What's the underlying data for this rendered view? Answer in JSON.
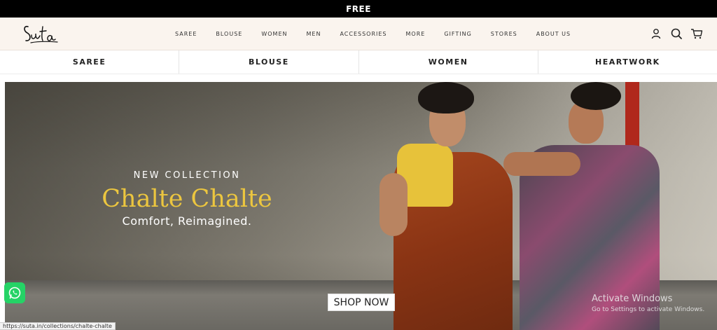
{
  "announcement": {
    "text": "FREE"
  },
  "header": {
    "logo_text": "Suta",
    "nav": [
      "SAREE",
      "BLOUSE",
      "WOMEN",
      "MEN",
      "ACCESSORIES",
      "MORE",
      "GIFTING",
      "STORES",
      "ABOUT US"
    ],
    "icons": [
      "user-icon",
      "search-icon",
      "cart-icon"
    ]
  },
  "category_bar": [
    "SAREE",
    "BLOUSE",
    "WOMEN",
    "HEARTWORK"
  ],
  "hero": {
    "eyebrow": "NEW COLLECTION",
    "title": "Chalte Chalte",
    "subtitle": "Comfort, Reimagined.",
    "cta": "SHOP NOW"
  },
  "windows_watermark": {
    "line1": "Activate Windows",
    "line2": "Go to Settings to activate Windows."
  },
  "status_url": "https://suta.in/collections/chalte-chalte",
  "colors": {
    "accent_title": "#ecc63f",
    "announce_bg": "#000000",
    "header_bg": "#faf4ee",
    "whatsapp": "#25d366"
  }
}
